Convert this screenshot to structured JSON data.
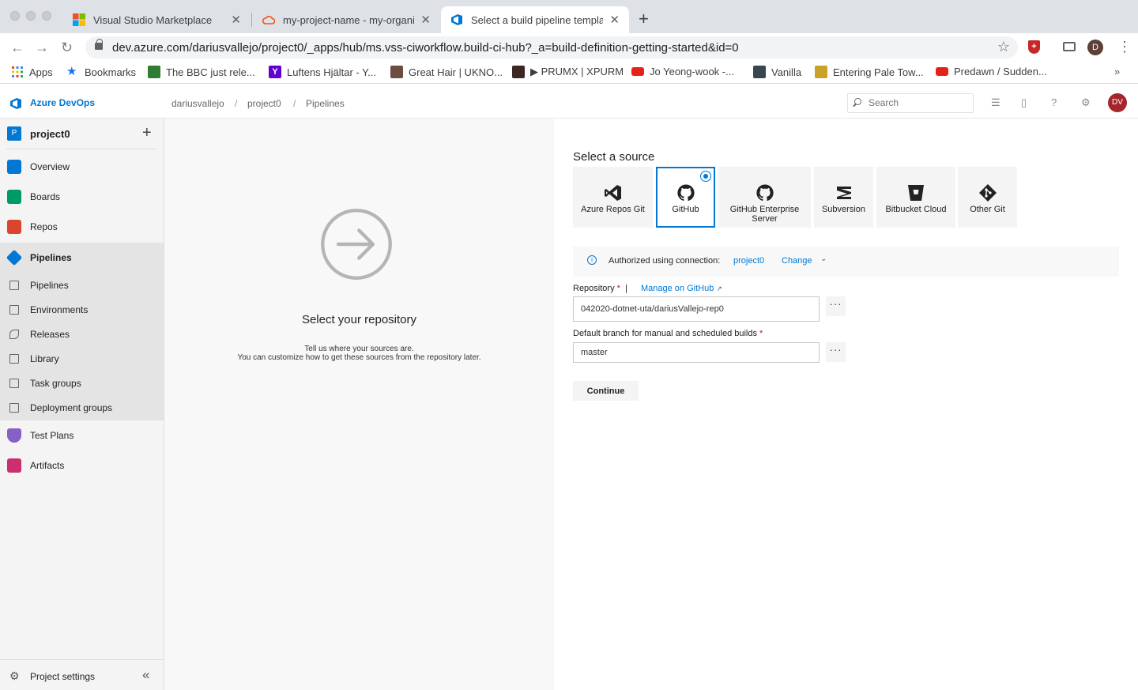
{
  "browser": {
    "tabs": [
      {
        "title": "Visual Studio Marketplace"
      },
      {
        "title": "my-project-name - my-organiz"
      },
      {
        "title": "Select a build pipeline templat"
      }
    ],
    "url": "dev.azure.com/dariusvallejo/project0/_apps/hub/ms.vss-ciworkflow.build-ci-hub?_a=build-definition-getting-started&id=0",
    "profile_initial": "D",
    "bookmarks": [
      {
        "label": "Apps",
        "icon": "apps-grid-icon",
        "color": "#1a73e8"
      },
      {
        "label": "Bookmarks",
        "icon": "star-icon",
        "color": "#1a73e8"
      },
      {
        "label": "The BBC just rele...",
        "icon": "site-icon",
        "color": "#2e7d32"
      },
      {
        "label": "Luftens Hjältar - Y...",
        "icon": "yahoo-icon",
        "color": "#6001d2"
      },
      {
        "label": "Great Hair | UKNO...",
        "icon": "site-icon",
        "color": "#6d4c41"
      },
      {
        "label": "▶ PRUMX | XPURM",
        "icon": "site-icon",
        "color": "#3e2723"
      },
      {
        "label": "Jo Yeong-wook -...",
        "icon": "youtube-icon",
        "color": "#e62117"
      },
      {
        "label": "Vanilla",
        "icon": "site-icon",
        "color": "#37474f"
      },
      {
        "label": "Entering Pale Tow...",
        "icon": "site-icon",
        "color": "#c9a227"
      },
      {
        "label": "Predawn / Sudden...",
        "icon": "youtube-icon",
        "color": "#e62117"
      }
    ],
    "bookmarks_more": "»"
  },
  "header": {
    "brand": "Azure DevOps",
    "breadcrumb": [
      "dariusvallejo",
      "project0",
      "Pipelines"
    ],
    "search_placeholder": "Search",
    "avatar_initials": "DV"
  },
  "sidebar": {
    "project_badge": "P",
    "project_name": "project0",
    "items": [
      {
        "label": "Overview",
        "color": "#0078d4"
      },
      {
        "label": "Boards",
        "color": "#009a66"
      },
      {
        "label": "Repos",
        "color": "#d9462d"
      },
      {
        "label": "Pipelines",
        "color": "#0078d4"
      },
      {
        "label": "Test Plans",
        "color": "#8661c5"
      },
      {
        "label": "Artifacts",
        "color": "#cc2f6d"
      }
    ],
    "sub_items": [
      "Pipelines",
      "Environments",
      "Releases",
      "Library",
      "Task groups",
      "Deployment groups"
    ],
    "settings_label": "Project settings"
  },
  "middle": {
    "icon": "arrow-right-circle-icon",
    "title": "Select your repository",
    "desc_line1": "Tell us where your sources are.",
    "desc_line2": "You can customize how to get these sources from the repository later."
  },
  "source": {
    "label": "Select a source",
    "accent": "#0078d4",
    "options": [
      {
        "label": "Azure Repos Git",
        "icon": "visual-studio-icon",
        "selected": false
      },
      {
        "label": "GitHub",
        "icon": "github-icon",
        "selected": true
      },
      {
        "label": "GitHub Enterprise Server",
        "icon": "github-icon",
        "selected": false
      },
      {
        "label": "Subversion",
        "icon": "subversion-icon",
        "selected": false
      },
      {
        "label": "Bitbucket Cloud",
        "icon": "bitbucket-icon",
        "selected": false
      },
      {
        "label": "Other Git",
        "icon": "git-icon",
        "selected": false
      }
    ]
  },
  "auth": {
    "text": "Authorized using connection:",
    "connection": "project0",
    "change": "Change"
  },
  "form": {
    "repository_label": "Repository",
    "required_mark": "*",
    "separator": "|",
    "manage_link": "Manage on GitHub",
    "repository_value": "042020-dotnet-uta/dariusVallejo-rep0",
    "branch_label": "Default branch for manual and scheduled builds",
    "branch_value": "master",
    "more_label": "···",
    "continue_label": "Continue"
  }
}
